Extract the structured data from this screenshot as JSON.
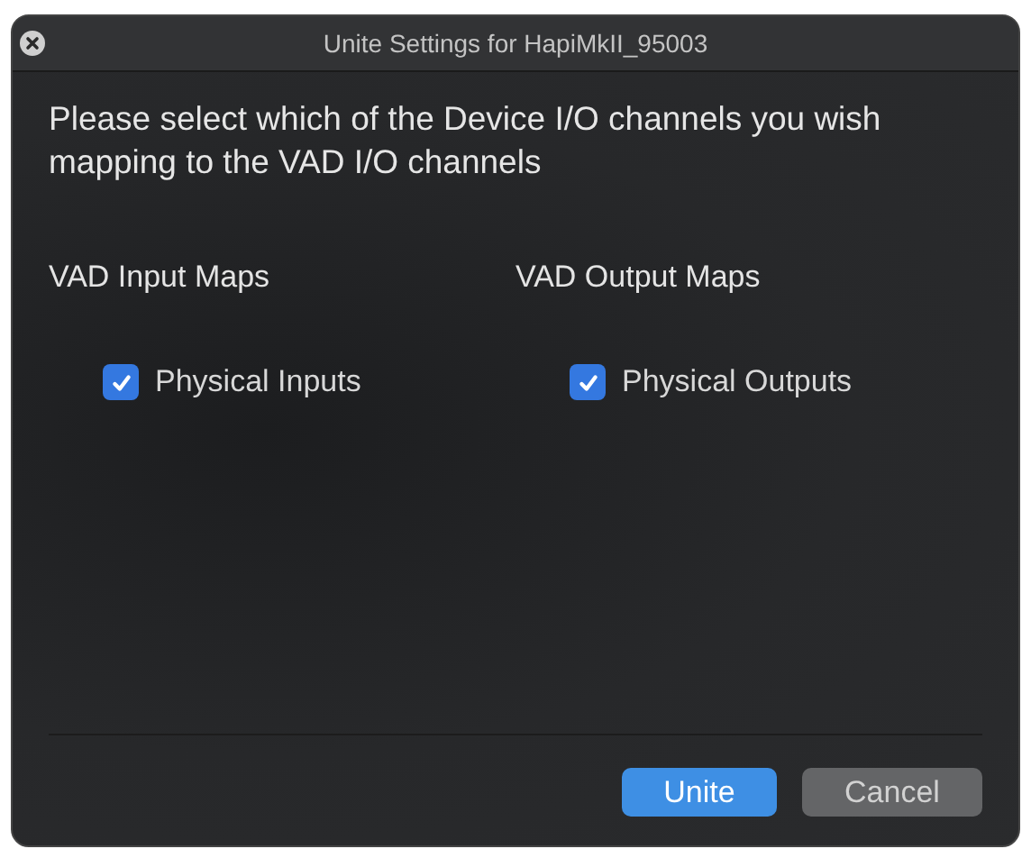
{
  "window": {
    "title": "Unite Settings for HapiMkII_95003"
  },
  "prompt": "Please select which of the Device I/O channels you wish mapping to the VAD I/O channels",
  "groups": [
    {
      "heading": "VAD Input Maps",
      "options": [
        {
          "label": "Physical Inputs",
          "checked": true
        }
      ]
    },
    {
      "heading": "VAD Output Maps",
      "options": [
        {
          "label": "Physical Outputs",
          "checked": true
        }
      ]
    }
  ],
  "buttons": [
    {
      "label": "Unite",
      "kind": "primary"
    },
    {
      "label": "Cancel",
      "kind": "secondary"
    }
  ]
}
